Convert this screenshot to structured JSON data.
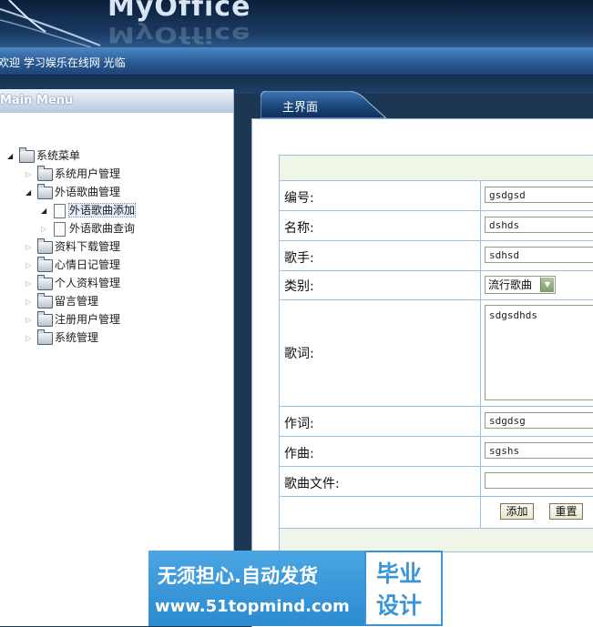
{
  "header": {
    "logo_text": "MyOffice",
    "welcome": "欢迎 学习娱乐在线网 光临"
  },
  "menu": {
    "title": "Main Menu",
    "root": "系统菜单",
    "items": [
      {
        "label": "系统用户管理",
        "expanded": false
      },
      {
        "label": "外语歌曲管理",
        "expanded": true
      },
      {
        "label": "外语歌曲添加",
        "child": true,
        "selected": true
      },
      {
        "label": "外语歌曲查询",
        "child": true
      },
      {
        "label": "资料下载管理",
        "expanded": false
      },
      {
        "label": "心情日记管理",
        "expanded": false
      },
      {
        "label": "个人资料管理",
        "expanded": false
      },
      {
        "label": "留言管理",
        "expanded": false
      },
      {
        "label": "注册用户管理",
        "expanded": false
      },
      {
        "label": "系统管理",
        "expanded": false
      }
    ]
  },
  "tab": {
    "label": "主界面"
  },
  "form": {
    "number_label": "编号:",
    "number_value": "gsdgsd",
    "name_label": "名称:",
    "name_value": "dshds",
    "singer_label": "歌手:",
    "singer_value": "sdhsd",
    "category_label": "类别:",
    "category_value": "流行歌曲",
    "lyrics_label": "歌词:",
    "lyrics_value": "sdgsdhds",
    "lyricist_label": "作词:",
    "lyricist_value": "sdgdsg",
    "composer_label": "作曲:",
    "composer_value": "sgshs",
    "file_label": "歌曲文件:",
    "file_value": "",
    "add_button": "添加",
    "reset_button": "重置"
  },
  "watermark": {
    "slogan": "无须担心.自动发货",
    "url": "www.51topmind.com",
    "brand_line1": "毕业",
    "brand_line2": "设计"
  },
  "colors": {
    "accent_blue": "#2a5b95",
    "form_border": "#9ec0df",
    "watermark_blue": "#3a94d8"
  }
}
